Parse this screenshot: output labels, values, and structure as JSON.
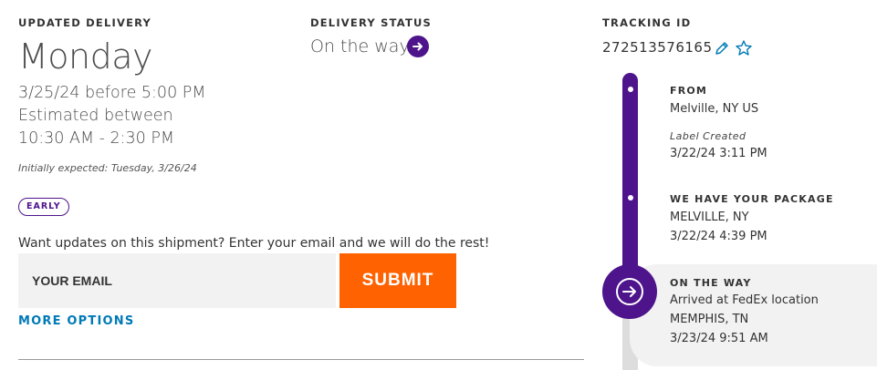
{
  "delivery": {
    "label": "UPDATED DELIVERY",
    "day": "Monday",
    "date_line": "3/25/24 before 5:00 PM",
    "estimated_line": "Estimated between",
    "time_window": "10:30 AM - 2:30 PM",
    "initially_expected": "Initially expected: Tuesday, 3/26/24",
    "badge": "EARLY"
  },
  "notifications": {
    "prompt": "Want updates on this shipment? Enter your email and we will do the rest!",
    "email_placeholder": "YOUR EMAIL",
    "submit_label": "SUBMIT",
    "more_options_label": "MORE OPTIONS"
  },
  "status": {
    "label": "DELIVERY STATUS",
    "value": "On the way",
    "arrow_icon": "arrow-right-circle-icon"
  },
  "tracking": {
    "label": "TRACKING ID",
    "number": "272513576165",
    "edit_icon": "pencil-icon",
    "favorite_icon": "star-outline-icon"
  },
  "timeline": {
    "events": [
      {
        "title": "FROM",
        "line1": "Melville, NY US",
        "italic": "Label Created",
        "line2": "3/22/24 3:11 PM"
      },
      {
        "title": "WE HAVE YOUR PACKAGE",
        "line1": "MELVILLE, NY",
        "line2": "3/22/24 4:39 PM"
      },
      {
        "title": "ON THE WAY",
        "line1": "Arrived at FedEx location",
        "line2": "MEMPHIS, TN",
        "line3": "3/23/24 9:51 AM"
      }
    ]
  },
  "colors": {
    "fedex_purple": "#4d148c",
    "fedex_orange": "#ff6200",
    "link_blue": "#007ab7",
    "input_gray": "#f2f2f2",
    "timeline_gray": "#dddddd"
  }
}
